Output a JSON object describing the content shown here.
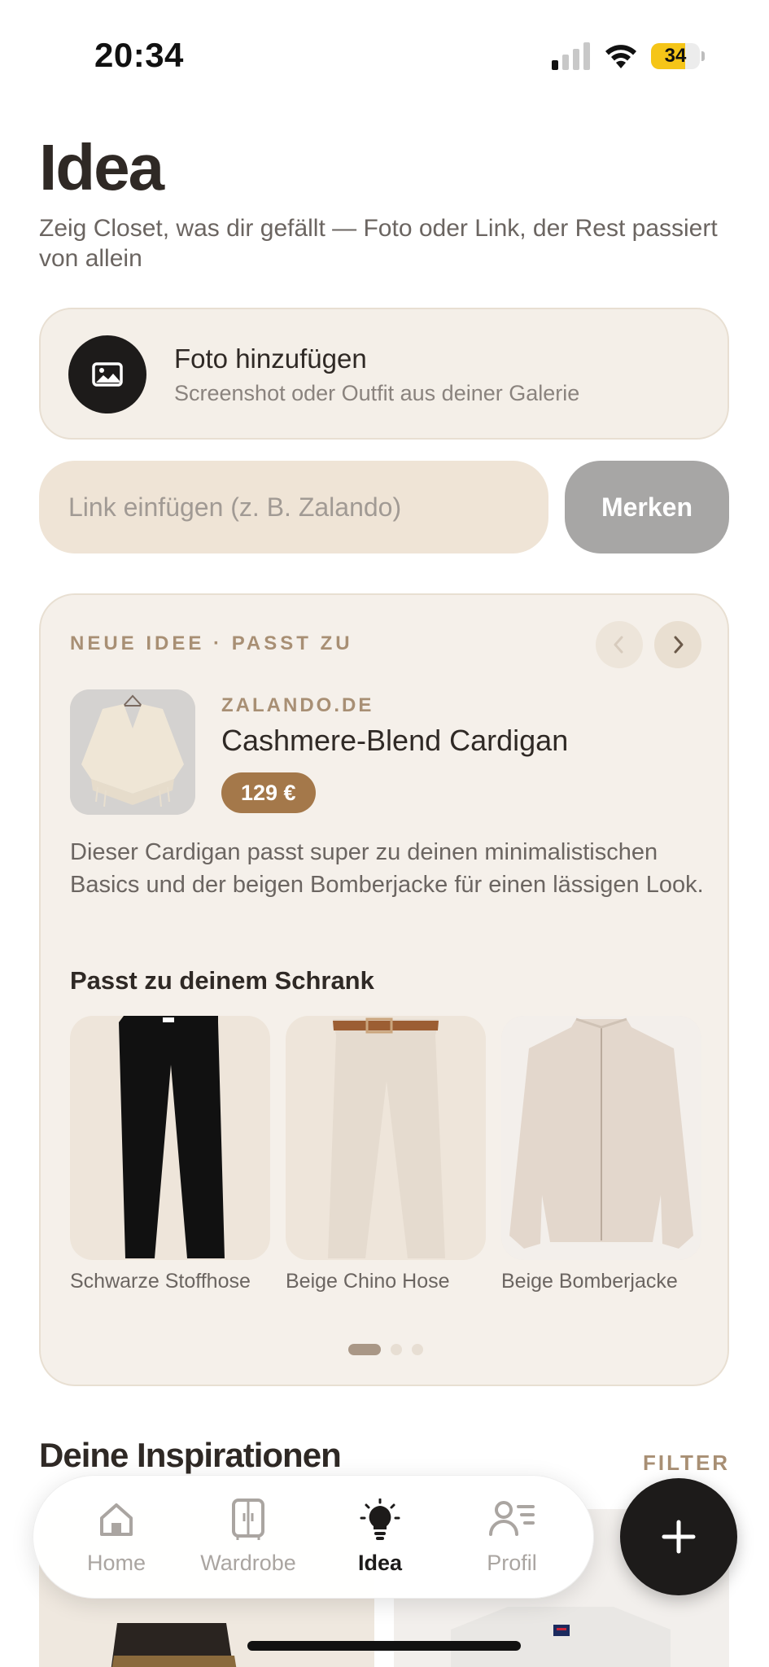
{
  "status_bar": {
    "time": "20:34",
    "battery": "34",
    "battery_level": 0.34
  },
  "header": {
    "title": "Idea",
    "subtitle": "Zeig Closet, was dir gefällt — Foto oder Link, der Rest passiert von allein"
  },
  "photo_card": {
    "title": "Foto hinzufügen",
    "subtitle": "Screenshot oder Outfit aus deiner Galerie",
    "icon": "image-icon"
  },
  "link_row": {
    "placeholder": "Link einfügen (z. B. Zalando)",
    "value": "",
    "save_label": "Merken"
  },
  "idea_card": {
    "label": "NEUE IDEE · PASST ZU",
    "shop": "ZALANDO.DE",
    "product_name": "Cashmere-Blend Cardigan",
    "price": "129 €",
    "description": "Dieser Cardigan passt super zu deinen minimalistischen Basics und der beigen Bomberjacke für einen lässigen Look.",
    "match_heading": "Passt zu deinem Schrank",
    "matches": [
      {
        "label": "Schwarze Stoffhose"
      },
      {
        "label": "Beige Chino Hose"
      },
      {
        "label": "Beige Bomberjacke"
      }
    ],
    "pagination": {
      "current": 1,
      "total": 3
    }
  },
  "inspirations": {
    "title": "Deine Inspirationen",
    "filter_label": "FILTER"
  },
  "tab_bar": {
    "items": [
      {
        "label": "Home",
        "icon": "home-icon",
        "active": false
      },
      {
        "label": "Wardrobe",
        "icon": "wardrobe-icon",
        "active": false
      },
      {
        "label": "Idea",
        "icon": "lightbulb-icon",
        "active": true
      },
      {
        "label": "Profil",
        "icon": "profile-icon",
        "active": false
      }
    ]
  },
  "fab": {
    "icon": "plus-icon"
  },
  "colors": {
    "accent": "#a4784a",
    "label_brown": "#a88f74",
    "card_bg": "#f5f0ea",
    "dark": "#1d1b1a"
  }
}
